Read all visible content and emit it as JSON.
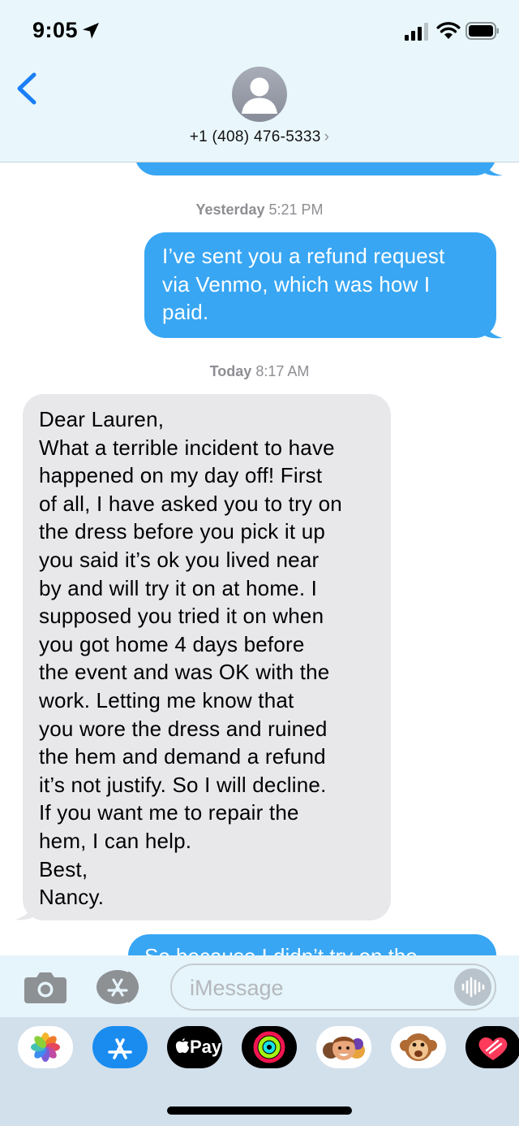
{
  "status_bar": {
    "time": "9:05"
  },
  "header": {
    "contact": "+1 (408) 476-5333",
    "chevron": "›",
    "icons": [
      "back-chevron-icon",
      "person-avatar-icon",
      "location-arrow-icon",
      "signal-icon",
      "wifi-icon",
      "battery-icon"
    ]
  },
  "messages": {
    "timestamp1_day": "Yesterday",
    "timestamp1_time": "5:21 PM",
    "sent1": [
      "I’ve sent you a refund request",
      "via Venmo, which was how I",
      "paid."
    ],
    "timestamp2_day": "Today",
    "timestamp2_time": "8:17 AM",
    "received1": [
      "Dear Lauren,",
      "What a terrible incident to have",
      "happened on my day off!  First",
      "of all, I have asked you to try on",
      "the dress before you pick it up",
      "you said it’s ok you lived near",
      "by and will try it on at home.  I",
      "supposed you tried it on when",
      "you got home 4 days before",
      "the event and was OK with the",
      "work.  Letting me know that",
      "you wore the dress and ruined",
      "the hem and demand a refund",
      "it’s not justify.  So I will decline.",
      "If you want me to repair the",
      "hem, I can help.",
      "Best,",
      "Nancy."
    ],
    "sent2_partial": "So because I didn’t try on the"
  },
  "input_bar": {
    "placeholder": "iMessage"
  },
  "app_drawer": {
    "apps": [
      "photos-app",
      "app-store-app",
      "apple-pay-app",
      "activity-app",
      "memoji-app",
      "animoji-app",
      "digital-touch-app"
    ],
    "apple_pay_label": "Pay"
  },
  "colors": {
    "sent_bubble": "#38a6f3",
    "received_bubble": "#e8e8eb",
    "header_bg": "#e9f7fc",
    "accent": "#1a7ef5"
  }
}
